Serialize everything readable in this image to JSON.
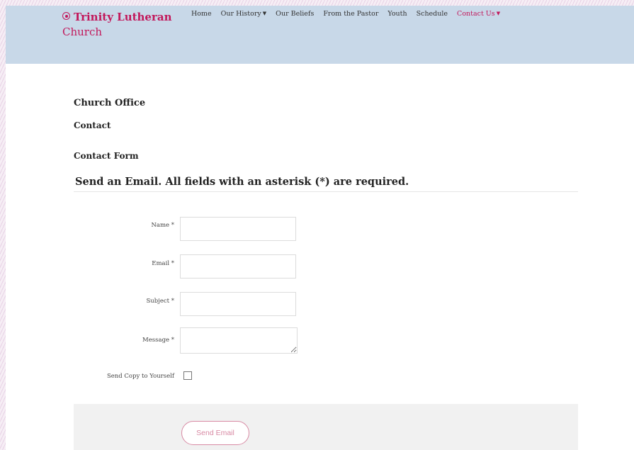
{
  "header": {
    "brand_line1": "Trinity Lutheran",
    "brand_line2": "Church",
    "nav": [
      {
        "label": "Home",
        "has_dropdown": false
      },
      {
        "label": "Our History",
        "has_dropdown": true
      },
      {
        "label": "Our Beliefs",
        "has_dropdown": false
      },
      {
        "label": "From the Pastor",
        "has_dropdown": false
      },
      {
        "label": "Youth",
        "has_dropdown": false
      },
      {
        "label": "Schedule",
        "has_dropdown": false
      },
      {
        "label": "Contact Us",
        "has_dropdown": true,
        "active": true
      }
    ]
  },
  "content": {
    "title": "Church Office",
    "subtitle": "Contact",
    "form_title": "Contact Form",
    "form_heading": "Send an Email. All fields with an asterisk (*) are required."
  },
  "form": {
    "name_label": "Name *",
    "name_value": "",
    "email_label": "Email *",
    "email_value": "",
    "subject_label": "Subject *",
    "subject_value": "",
    "message_label": "Message *",
    "message_value": "",
    "copy_label": "Send Copy to Yourself",
    "copy_checked": false,
    "submit_label": "Send Email"
  },
  "colors": {
    "accent": "#c2185b",
    "header_bg": "#c8d8e8",
    "button_border": "#d88aa4"
  }
}
